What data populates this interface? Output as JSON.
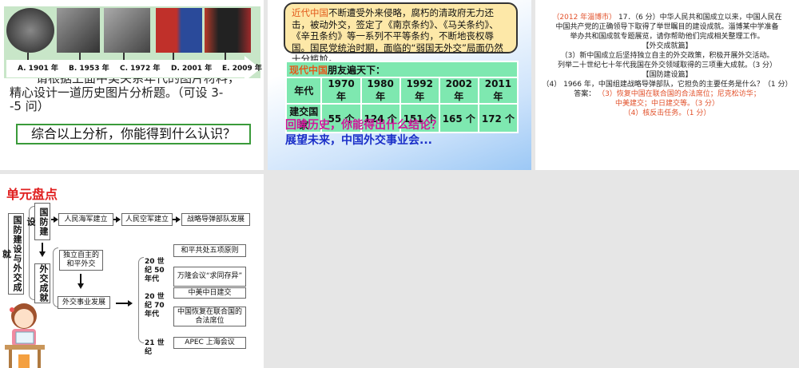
{
  "slide1": {
    "timeline": [
      "A. 1901 年",
      "B. 1953 年",
      "C. 1972 年",
      "D. 2001 年",
      "E. 2009 年"
    ],
    "question_hidden": "请根据上面中美关系年代的图片材料，",
    "question": "精心设计一道历史图片分析题。（可设 3--5 问）",
    "prompt": "综合以上分析，你能得到什么认识？"
  },
  "slide2": {
    "modern_label": "近代中国",
    "modern_text": "不断遭受外来侵略，腐朽的清政府无力还击，被动外交，签定了《南京条约》、《马关条约》、《辛丑条约》等一系列不平等条约，不断地丧权辱国。国民党统治时期，面临的“弱国无外交”局面仍然十分尴尬。",
    "table_title_red": "现代中国",
    "table_title": "朋友遍天下：",
    "headers": [
      "年代",
      "1970 年",
      "1980 年",
      "1992 年",
      "2002 年",
      "2011 年"
    ],
    "row": [
      "建交国家",
      "55 个",
      "124 个",
      "151 个",
      "165 个",
      "172 个"
    ],
    "line1": "回眸历史，你能得出什么结论？",
    "line2": "展望未来，中国外交事业会..."
  },
  "slide3": {
    "source": "（2012 年淄博市）",
    "q1": "17．（6 分）中华人民共和国成立以来，中国人民在",
    "q2": "中国共产党的正确领导下取得了举世瞩目的建设成就。淄博某中学准备",
    "q3": "举办共和国成就专题展览，请你帮助他们完成相关整理工作。",
    "h1": "【外交成就篇】",
    "q4": "（3）新中国成立后坚持独立自主的外交政策，积极开展外交活动。",
    "q5": "列举二十世纪七十年代我国在外交领域取得的三项重大成就。（3 分）",
    "h2": "【国防建设篇】",
    "q6": "（4） 1966 年，中国组建战略导弹部队，它担负的主要任务是什么？（1 分）",
    "ans_label": "答案：",
    "a1": "（3）恢复中国在联合国的合法席位；尼克松访华；",
    "a2": "中美建交；中日建交等。（3 分）",
    "a3": "（4）核反击任务。（1 分）"
  },
  "slide4": {
    "title": "单元盘点",
    "main": "国防建设与外交成",
    "main_tail": "就",
    "defense": "国防建设",
    "diplomacy": "外交成就",
    "defense_steps": [
      "人民海军建立",
      "人民空军建立",
      "战略导弹部队发展"
    ],
    "policy": "独立自主的和平外交",
    "development": "外交事业发展",
    "eras": [
      "20 世纪 50 年代",
      "20 世纪 70 年代",
      "21 世纪"
    ],
    "events": [
      "和平共处五项原则",
      "万隆会议“求同存异”",
      "中美中日建交",
      "中国恢复在联合国的合法席位",
      "APEC 上海会议"
    ]
  }
}
